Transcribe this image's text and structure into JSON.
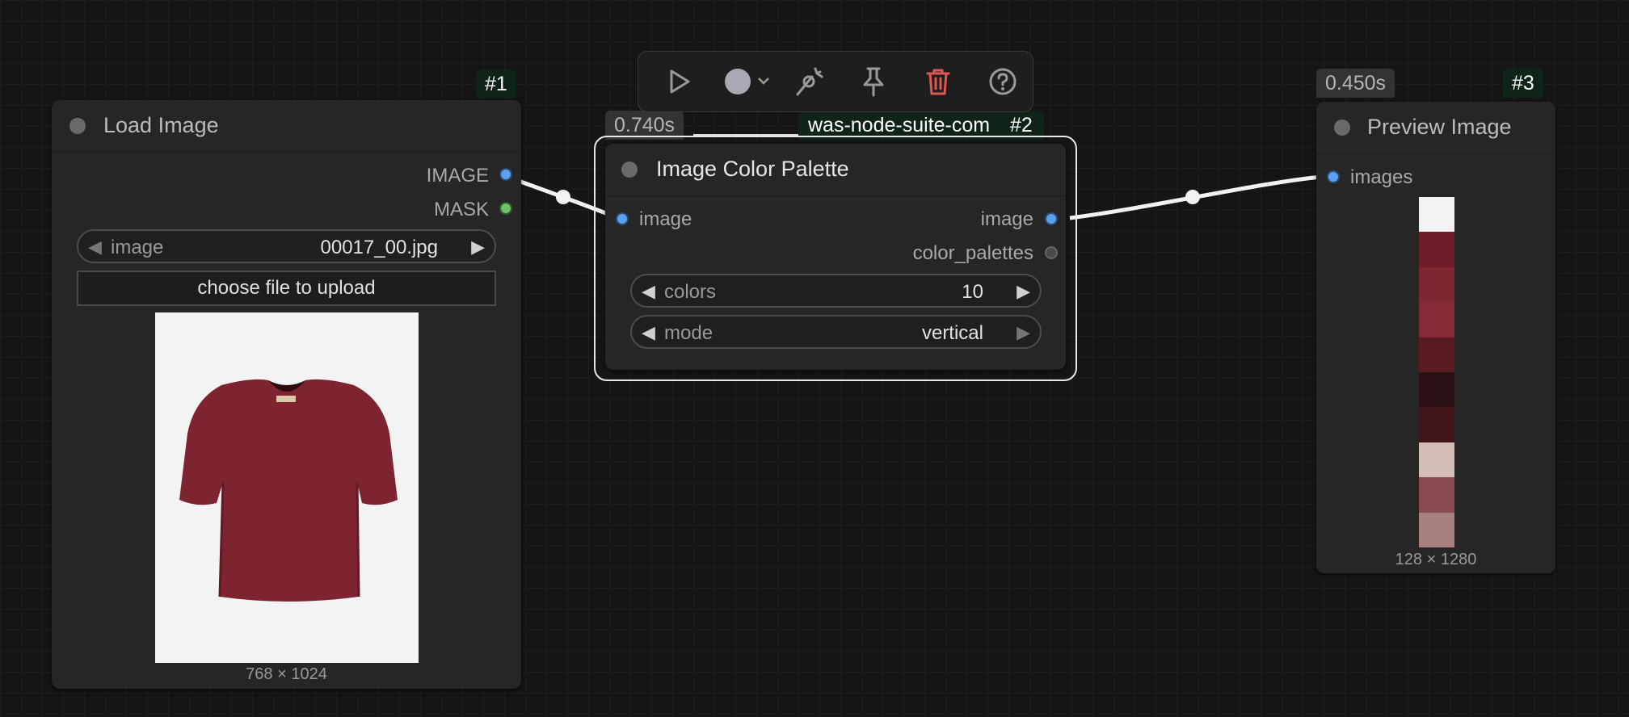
{
  "colors": {
    "canvas_bg": "#151515",
    "node_bg": "#262626",
    "image_slot": "#5aa2f0",
    "mask_slot": "#6ec26c",
    "delete_red": "#e05555",
    "selection_outline": "#ffffff"
  },
  "toolbar": {
    "buttons": [
      "play-icon",
      "color-circle-icon",
      "chevron-down-icon",
      "bypass-wand-icon",
      "pin-icon",
      "trash-icon",
      "help-icon"
    ]
  },
  "node1": {
    "id_badge": "#1",
    "title": "Load Image",
    "outputs": {
      "image": "IMAGE",
      "mask": "MASK"
    },
    "image_widget": {
      "name": "image",
      "value": "00017_00.jpg"
    },
    "upload_button": "choose file to upload",
    "preview_size": "768 × 1024"
  },
  "node2": {
    "time_badge": "0.740s",
    "source_badge": "was-node-suite-com",
    "id_badge": "#2",
    "title": "Image Color Palette",
    "input": "image",
    "outputs": {
      "image": "image",
      "color_palettes": "color_palettes"
    },
    "colors_widget": {
      "name": "colors",
      "value": "10"
    },
    "mode_widget": {
      "name": "mode",
      "value": "vertical"
    }
  },
  "node3": {
    "time_badge": "0.450s",
    "id_badge": "#3",
    "title": "Preview Image",
    "input": "images",
    "palette_swatches": [
      "#f2f2f2",
      "#6f1e29",
      "#7e2632",
      "#852b37",
      "#5a1a22",
      "#2b1114",
      "#401418",
      "#d6beb8",
      "#8a4b52",
      "#a98080"
    ],
    "preview_size": "128 × 1280"
  }
}
